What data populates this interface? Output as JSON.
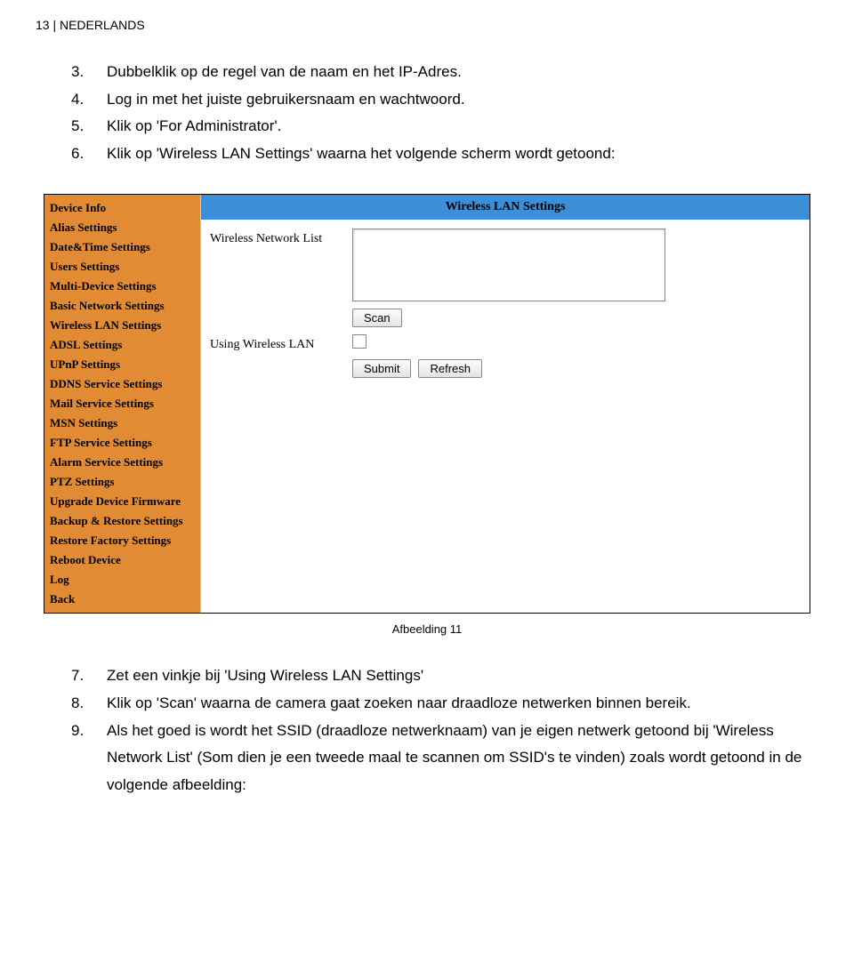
{
  "header": "13 | NEDERLANDS",
  "instructions_top": [
    {
      "num": "3.",
      "text": "Dubbelklik op de regel van de naam en het IP-Adres."
    },
    {
      "num": "4.",
      "text": "Log in met het juiste gebruikersnaam en wachtwoord."
    },
    {
      "num": "5.",
      "text": "Klik op 'For Administrator'."
    },
    {
      "num": "6.",
      "text": "Klik op 'Wireless LAN Settings' waarna het volgende scherm wordt getoond:"
    }
  ],
  "screenshot": {
    "sidebar": [
      "Device Info",
      "Alias Settings",
      "Date&Time Settings",
      "Users Settings",
      "Multi-Device Settings",
      "Basic Network Settings",
      "Wireless LAN Settings",
      "ADSL Settings",
      "UPnP Settings",
      "DDNS Service Settings",
      "Mail Service Settings",
      "MSN Settings",
      "FTP Service Settings",
      "Alarm Service Settings",
      "PTZ Settings",
      "Upgrade Device Firmware",
      "Backup & Restore Settings",
      "Restore Factory Settings",
      "Reboot Device",
      "Log",
      "Back"
    ],
    "title": "Wireless LAN Settings",
    "label_list": "Wireless Network List",
    "scan_label": "Scan",
    "label_using": "Using Wireless LAN",
    "submit_label": "Submit",
    "refresh_label": "Refresh"
  },
  "caption": "Afbeelding 11",
  "instructions_bottom": [
    {
      "num": "7.",
      "text": "Zet een vinkje bij 'Using Wireless LAN Settings'"
    },
    {
      "num": "8.",
      "text": "Klik op 'Scan' waarna de camera gaat zoeken naar draadloze netwerken binnen bereik."
    },
    {
      "num": "9.",
      "text": "Als het goed is wordt het SSID (draadloze netwerknaam) van je eigen netwerk getoond bij 'Wireless Network List' (Som dien je een tweede maal te scannen om SSID's te vinden) zoals wordt getoond in de volgende afbeelding:"
    }
  ]
}
